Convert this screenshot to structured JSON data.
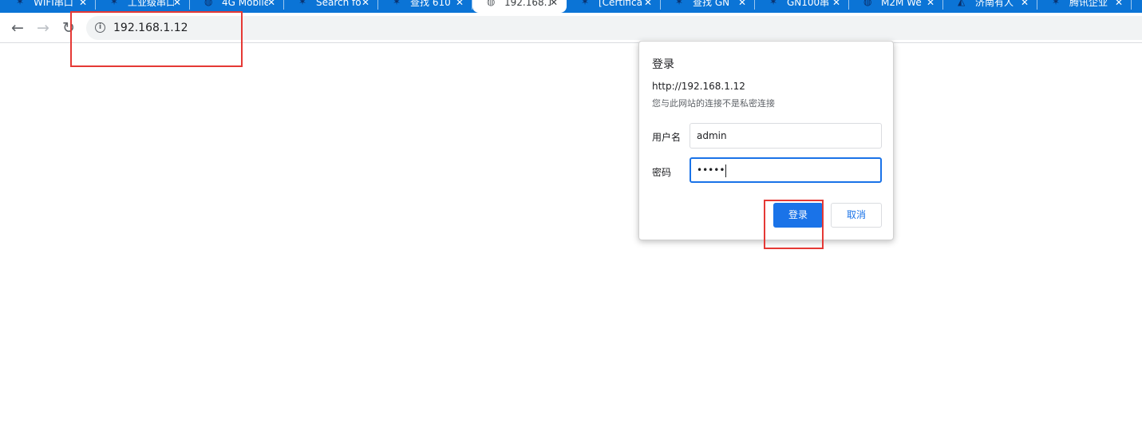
{
  "tabs": [
    {
      "title": "WIFI串口",
      "icon": "star-icon"
    },
    {
      "title": "工业级串口",
      "icon": "star-icon"
    },
    {
      "title": "4G Mobile",
      "icon": "globe-icon"
    },
    {
      "title": "Search fo",
      "icon": "star-icon"
    },
    {
      "title": "查找 610",
      "icon": "star-icon"
    },
    {
      "title": "192.168.1",
      "icon": "globe-icon",
      "active": true
    },
    {
      "title": "[Certifica",
      "icon": "star-icon"
    },
    {
      "title": "查找 GN",
      "icon": "star-icon"
    },
    {
      "title": "GN100串",
      "icon": "star-icon"
    },
    {
      "title": "M2M We",
      "icon": "globe-icon"
    },
    {
      "title": "济南有人",
      "icon": "logo-icon"
    },
    {
      "title": "腾讯企业",
      "icon": "star-icon"
    }
  ],
  "toolbar": {
    "url": "192.168.1.12"
  },
  "dialog": {
    "title": "登录",
    "origin": "http://192.168.1.12",
    "warning": "您与此网站的连接不是私密连接",
    "username_label": "用户名",
    "username_value": "admin",
    "password_label": "密码",
    "password_value": "•••••",
    "login_button": "登录",
    "cancel_button": "取消"
  },
  "colors": {
    "tabstrip": "#0b74d6",
    "accent": "#1a73e8",
    "highlight": "#e53935"
  }
}
